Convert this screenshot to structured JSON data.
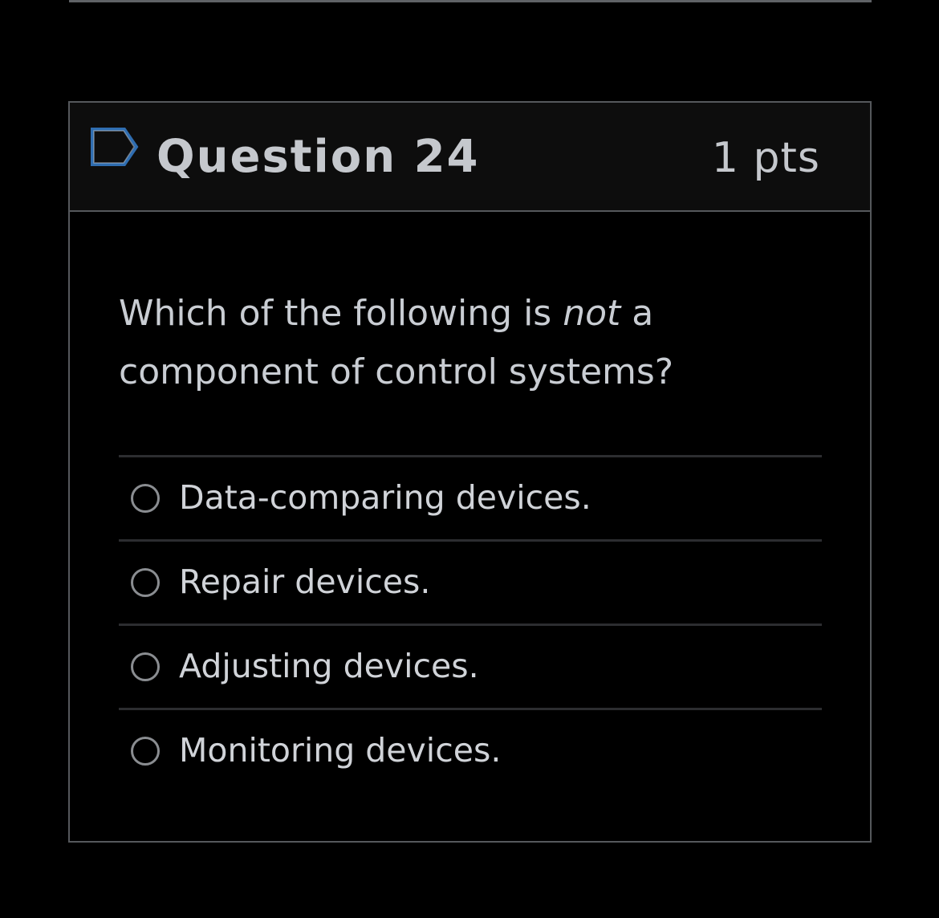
{
  "colors": {
    "background": "#000000",
    "header_background": "#0d0d0d",
    "border": "#55585c",
    "text": "#c9cdd3",
    "flag_outline": "#2f6db0",
    "radio_border": "#8a8d91"
  },
  "question": {
    "flag_icon": "bookmark-flag-icon",
    "title": "Question 24",
    "points": "1 pts",
    "text_before": "Which of the following is ",
    "text_emphasis": "not",
    "text_after": " a component of control systems?",
    "answers": [
      {
        "label": "Data-comparing devices.",
        "selected": false
      },
      {
        "label": "Repair devices.",
        "selected": false
      },
      {
        "label": "Adjusting devices.",
        "selected": false
      },
      {
        "label": "Monitoring devices.",
        "selected": false
      }
    ]
  }
}
